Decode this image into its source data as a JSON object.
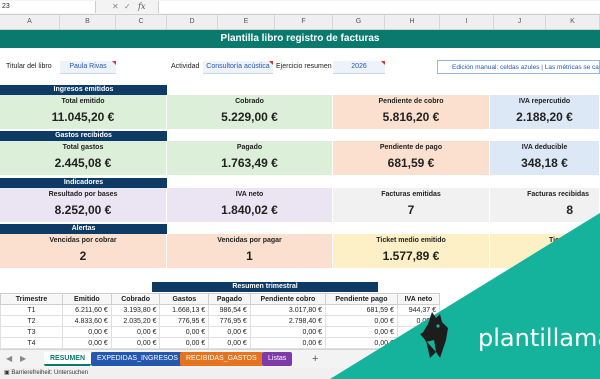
{
  "formula_bar": {
    "name_box": "23",
    "cancel": "✕",
    "enter": "✓",
    "fx": "fx",
    "value": ""
  },
  "columns": [
    "A",
    "B",
    "C",
    "D",
    "E",
    "F",
    "G",
    "H",
    "I",
    "J",
    "K"
  ],
  "title": "Plantilla libro registro de facturas",
  "header": {
    "titular_label": "Titular del libro",
    "titular_value": "Paula Rivas",
    "actividad_label": "Actividad",
    "actividad_value": "Consultoría acústica",
    "ejercicio_label": "Ejercicio resumen",
    "ejercicio_value": "2026",
    "note": "Edición manual: celdas azules | Las métricas se calcu"
  },
  "ingresos": {
    "section": "Ingresos emitidos",
    "total_emitido": {
      "label": "Total emitido",
      "value": "11.045,20 €"
    },
    "cobrado": {
      "label": "Cobrado",
      "value": "5.229,00 €"
    },
    "pendiente": {
      "label": "Pendiente de cobro",
      "value": "5.816,20 €"
    },
    "iva_rep": {
      "label": "IVA repercutido",
      "value": "2.188,20 €"
    }
  },
  "gastos": {
    "section": "Gastos recibidos",
    "total": {
      "label": "Total gastos",
      "value": "2.445,08 €"
    },
    "pagado": {
      "label": "Pagado",
      "value": "1.763,49 €"
    },
    "pendiente": {
      "label": "Pendiente de pago",
      "value": "681,59 €"
    },
    "iva_ded": {
      "label": "IVA deducible",
      "value": "348,18 €"
    }
  },
  "indicadores": {
    "section": "Indicadores",
    "resultado": {
      "label": "Resultado por bases",
      "value": "8.252,00 €"
    },
    "iva_neto": {
      "label": "IVA neto",
      "value": "1.840,02 €"
    },
    "fact_emitidas": {
      "label": "Facturas emitidas",
      "value": "7"
    },
    "fact_recibidas": {
      "label": "Facturas recibidas",
      "value": "8"
    }
  },
  "alertas": {
    "section": "Alertas",
    "vencidas_cobrar": {
      "label": "Vencidas por cobrar",
      "value": "2"
    },
    "vencidas_pagar": {
      "label": "Vencidas por pagar",
      "value": "1"
    },
    "ticket_medio": {
      "label": "Ticket medio emitido",
      "value": "1.577,89 €"
    },
    "ticket_partial": {
      "label": "Tic",
      "value": ""
    }
  },
  "quarterly": {
    "title": "Resumen trimestral",
    "headers": [
      "Trimestre",
      "Emitido",
      "Cobrado",
      "Gastos",
      "Pagado",
      "Pendiente cobro",
      "Pendiente pago",
      "IVA neto"
    ],
    "rows": [
      [
        "T1",
        "6.211,60 €",
        "3.193,80 €",
        "1.668,13 €",
        "986,54 €",
        "3.017,80 €",
        "681,59 €",
        "944,37 €"
      ],
      [
        "T2",
        "4.833,60 €",
        "2.035,20 €",
        "776,95 €",
        "776,95 €",
        "2.798,40 €",
        "0,00 €",
        "0,00 €"
      ],
      [
        "T3",
        "0,00 €",
        "0,00 €",
        "0,00 €",
        "0,00 €",
        "0,00 €",
        "0,00 €",
        "0,00 €"
      ],
      [
        "T4",
        "0,00 €",
        "0,00 €",
        "0,00 €",
        "0,00 €",
        "0,00 €",
        "0,00 €",
        "0,00 €"
      ]
    ]
  },
  "tabs": [
    {
      "label": "RESUMEN",
      "color": "#ffffff"
    },
    {
      "label": "EXPEDIDAS_INGRESOS",
      "color": "#2457b0"
    },
    {
      "label": "RECIBIDAS_GASTOS",
      "color": "#e6731e"
    },
    {
      "label": "Listas",
      "color": "#7d3aa8"
    }
  ],
  "add_sheet": "+",
  "status": "Barrierefreiheit: Untersuchen",
  "logo": "plantillama",
  "colors": {
    "teal": "#0b7a6e",
    "navy": "#0d3b66",
    "logo_bg": "#16b39c"
  }
}
